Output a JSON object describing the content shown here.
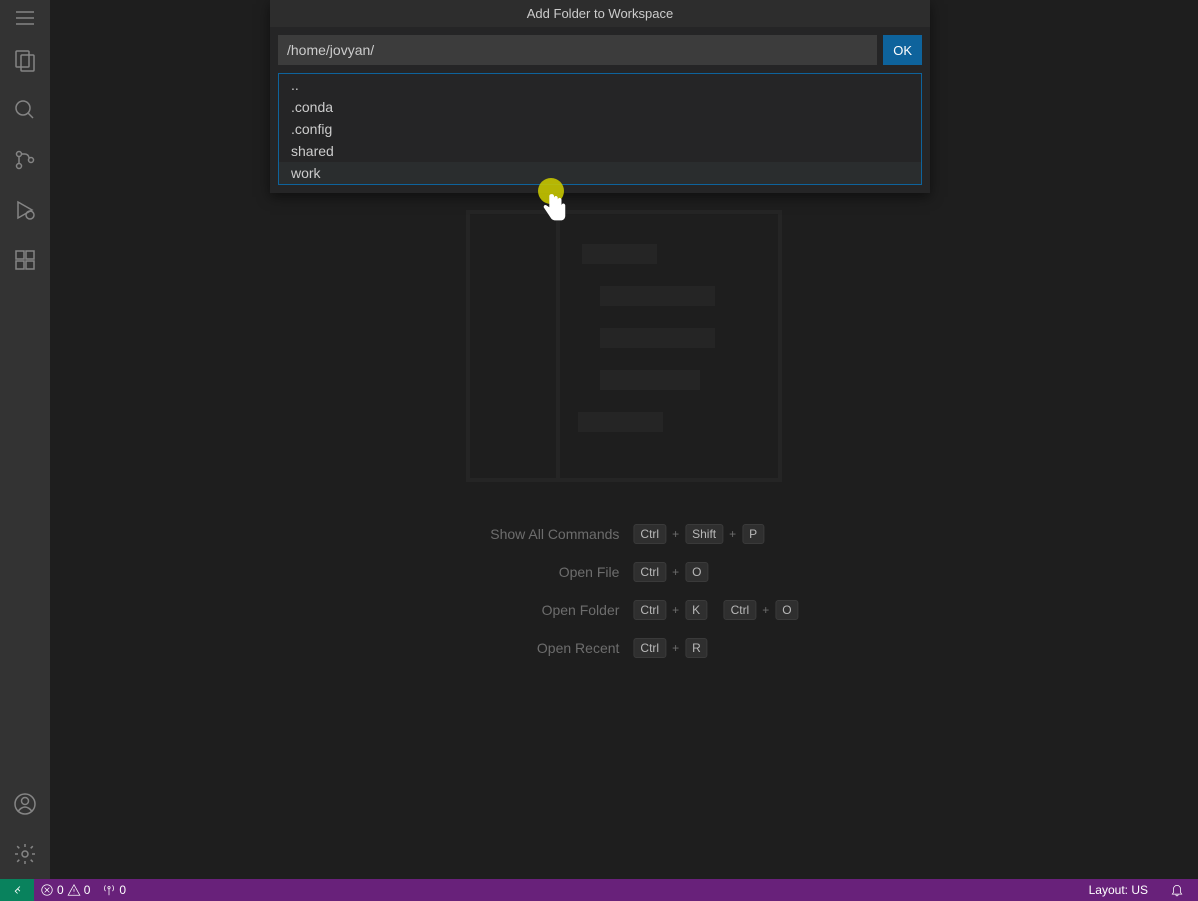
{
  "modal": {
    "title": "Add Folder to Workspace",
    "path_value": "/home/jovyan/",
    "ok_label": "OK",
    "suggestions": [
      "..",
      ".conda",
      ".config",
      "shared",
      "work"
    ]
  },
  "hints": {
    "show_all": "Show All Commands",
    "open_file": "Open File",
    "open_folder": "Open Folder",
    "open_recent": "Open Recent",
    "keys": {
      "ctrl": "Ctrl",
      "shift": "Shift",
      "p": "P",
      "o": "O",
      "k": "K",
      "r": "R"
    }
  },
  "status": {
    "errors": "0",
    "warnings": "0",
    "ports": "0",
    "layout": "Layout: US"
  }
}
